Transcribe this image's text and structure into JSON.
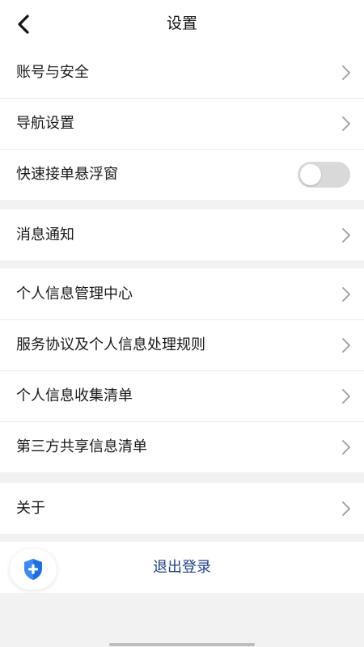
{
  "header": {
    "title": "设置",
    "back_icon": "chevron-left-icon"
  },
  "groups": [
    {
      "items": [
        {
          "label": "账号与安全",
          "control": "chevron-right-icon"
        },
        {
          "label": "导航设置",
          "control": "chevron-right-icon"
        },
        {
          "label": "快速接单悬浮窗",
          "control": "toggle",
          "toggle_on": false
        }
      ]
    },
    {
      "items": [
        {
          "label": "消息通知",
          "control": "chevron-right-icon"
        }
      ]
    },
    {
      "items": [
        {
          "label": "个人信息管理中心",
          "control": "chevron-right-icon"
        },
        {
          "label": "服务协议及个人信息处理规则",
          "control": "chevron-right-icon"
        },
        {
          "label": "个人信息收集清单",
          "control": "chevron-right-icon"
        },
        {
          "label": "第三方共享信息清单",
          "control": "chevron-right-icon"
        }
      ]
    },
    {
      "items": [
        {
          "label": "关于",
          "control": "chevron-right-icon"
        }
      ]
    }
  ],
  "logout": {
    "label": "退出登录",
    "color": "#1f3f86"
  },
  "float_badge": {
    "icon": "shield-plus-icon",
    "color": "#1f6fe0"
  },
  "colors": {
    "background": "#f2f2f2",
    "surface": "#ffffff",
    "text": "#1a1a1a",
    "chevron": "#9a9a9a",
    "toggle_off": "#d9d9d9"
  }
}
